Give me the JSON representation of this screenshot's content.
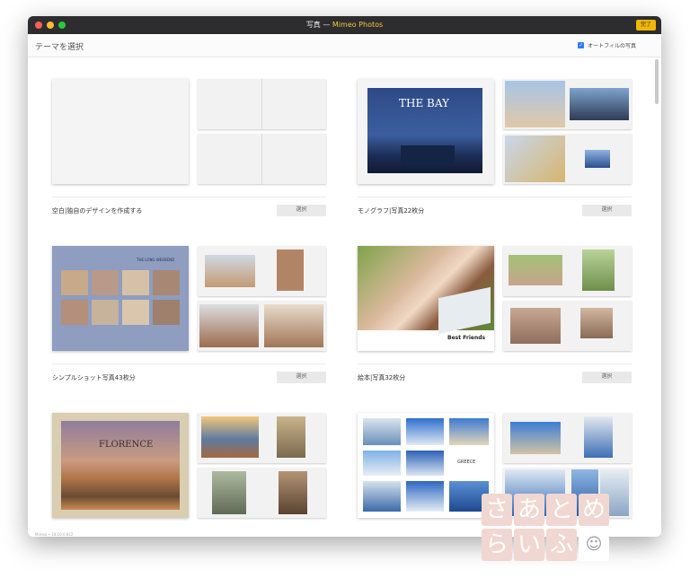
{
  "window": {
    "title_prefix": "写真 —",
    "title_app": "Mimeo Photos",
    "done_label": "完了"
  },
  "toolbar": {
    "page_title": "テーマを選択",
    "autofill_label": "オートフィルの写真",
    "autofill_checked": true
  },
  "themes": [
    {
      "label": "空白|独自のデザインを作成する",
      "select_label": "選択",
      "hero_text": ""
    },
    {
      "label": "モノグラフ|写真22枚分",
      "select_label": "選択",
      "hero_text": "THE BAY"
    },
    {
      "label": "シンプルショット写真43枚分",
      "select_label": "選択",
      "hero_text": "THE LONG WEEKEND"
    },
    {
      "label": "絵本|写真32枚分",
      "select_label": "選択",
      "hero_text": "Best Friends"
    },
    {
      "hero_text": "FLORENCE"
    },
    {
      "hero_text": "GREECE"
    }
  ],
  "footer": {
    "text": "Mimeo • 18.10.0.822"
  },
  "watermark": {
    "row1": [
      "さ",
      "あ",
      "と",
      "め"
    ],
    "row2": [
      "ら",
      "い",
      "ふ"
    ]
  },
  "colors": {
    "accent": "#2e7cf6",
    "done": "#f2b705",
    "titlebar": "#2d2d2f"
  }
}
